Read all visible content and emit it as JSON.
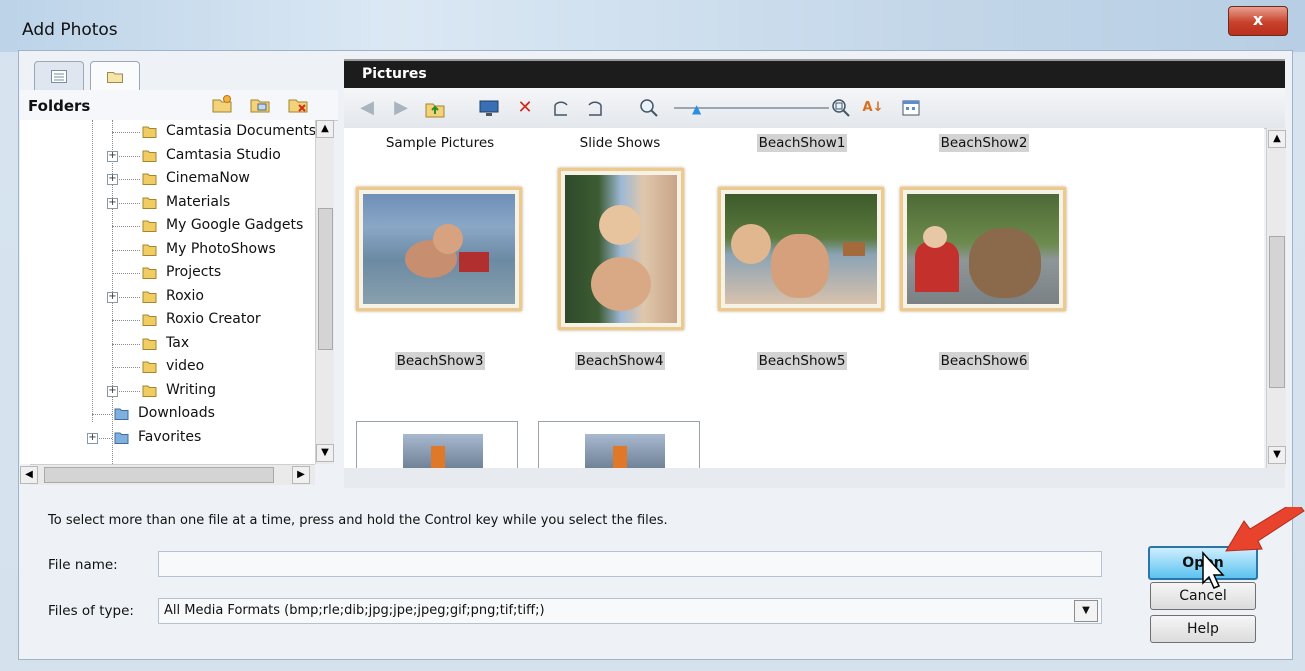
{
  "window": {
    "title": "Add Photos",
    "close_glyph": "x"
  },
  "left_pane": {
    "tabs": [
      {
        "icon": "list-icon"
      },
      {
        "icon": "folder-icon"
      }
    ],
    "header": "Folders",
    "header_icons": [
      "new-folder-icon",
      "copy-folder-icon",
      "delete-folder-icon"
    ],
    "tree_items": [
      {
        "label": "Camtasia Documents",
        "expander": false
      },
      {
        "label": "Camtasia Studio",
        "expander": true
      },
      {
        "label": "CinemaNow",
        "expander": true
      },
      {
        "label": "Materials",
        "expander": true
      },
      {
        "label": "My Google Gadgets",
        "expander": false
      },
      {
        "label": "My PhotoShows",
        "expander": false
      },
      {
        "label": "Projects",
        "expander": false
      },
      {
        "label": "Roxio",
        "expander": true
      },
      {
        "label": "Roxio Creator",
        "expander": false
      },
      {
        "label": "Tax",
        "expander": false
      },
      {
        "label": "video",
        "expander": false
      },
      {
        "label": "Writing",
        "expander": true
      },
      {
        "label": "Downloads",
        "expander": false
      },
      {
        "label": "Favorites",
        "expander": true
      }
    ]
  },
  "right_pane": {
    "title": "Pictures",
    "toolbar_icons": [
      "back-icon",
      "forward-icon",
      "up-folder-icon",
      "monitor-icon",
      "delete-icon",
      "rotate-left-icon",
      "rotate-right-icon",
      "zoom-icon",
      "zoom-in-icon",
      "sort-icon",
      "view-icon"
    ],
    "row1_captions": [
      "Sample Pictures",
      "Slide Shows",
      "BeachShow1",
      "BeachShow2"
    ],
    "row2_captions": [
      "BeachShow3",
      "BeachShow4",
      "BeachShow5",
      "BeachShow6"
    ]
  },
  "bottom": {
    "hint": "To select more than one file at a time, press and hold the Control key while you select the files.",
    "file_name_label": "File name:",
    "file_name_value": "",
    "files_of_type_label": "Files of type:",
    "files_of_type_value": "All Media Formats (bmp;rle;dib;jpg;jpe;jpeg;gif;png;tif;tiff;)",
    "open_label": "Open",
    "cancel_label": "Cancel",
    "help_label": "Help"
  },
  "colors": {
    "highlight_arrow": "#e8432c",
    "open_button": "#5cc3ef"
  }
}
